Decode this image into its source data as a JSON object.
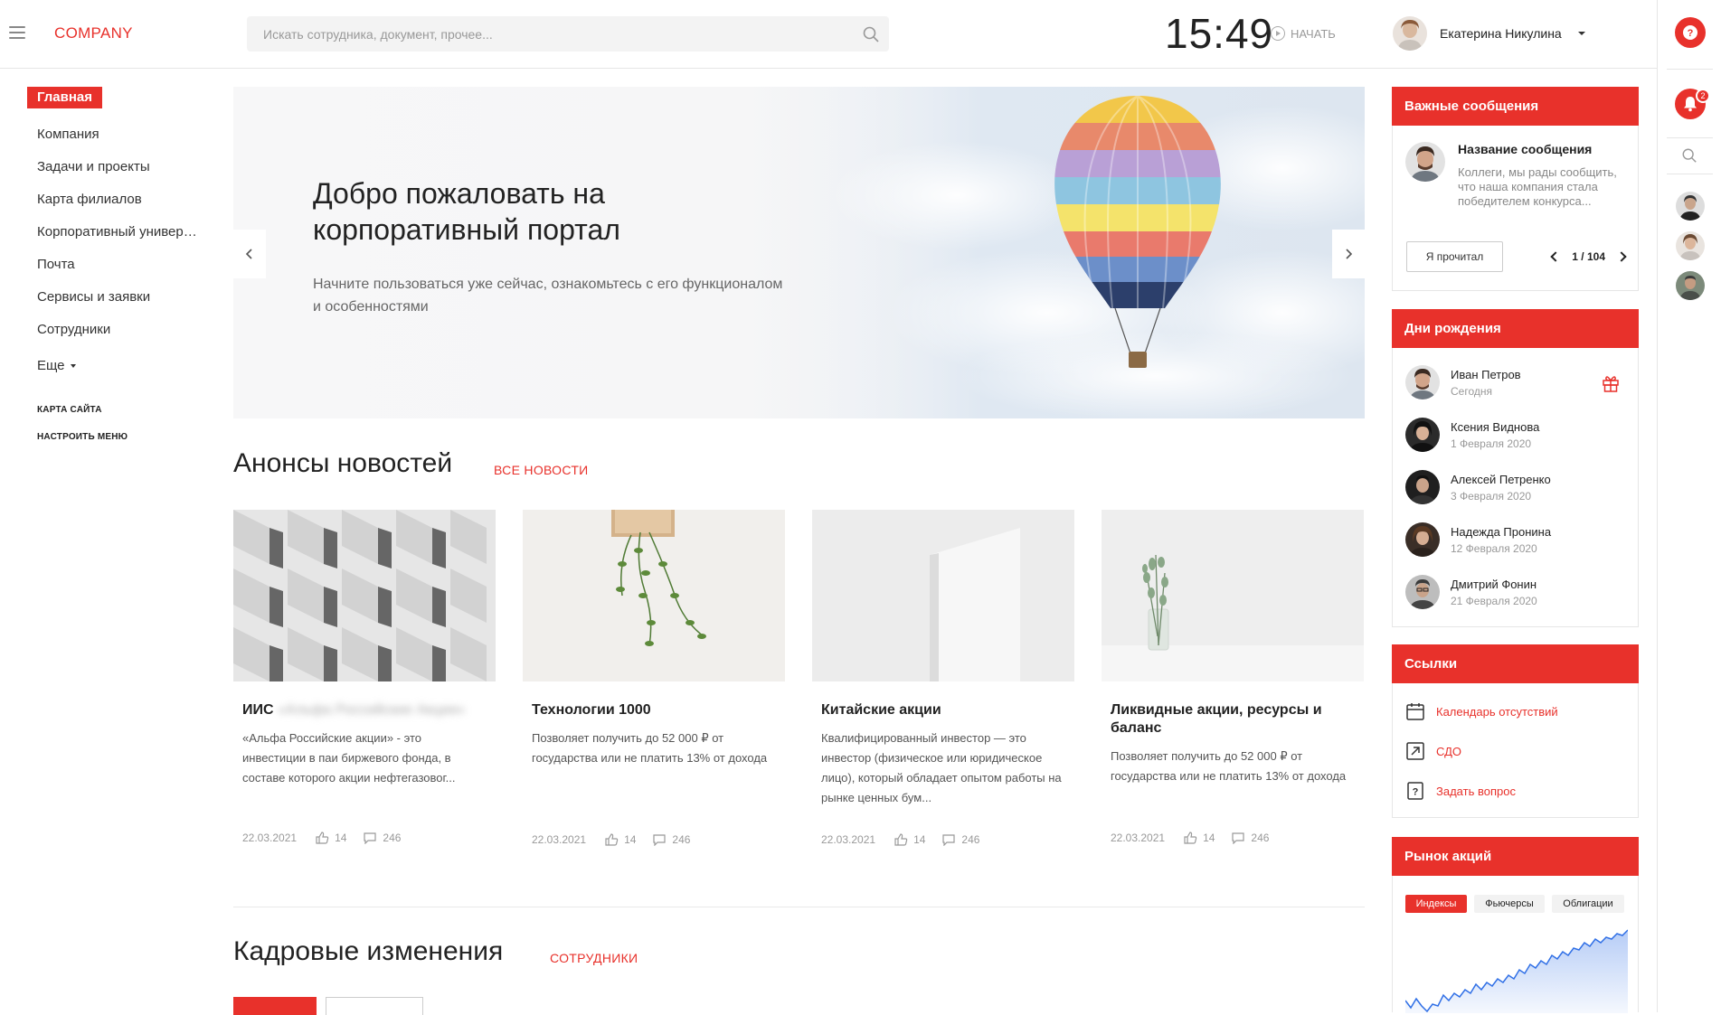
{
  "header": {
    "logo": "COMPANY",
    "search_placeholder": "Искать сотрудника, документ, прочее...",
    "clock": "15:49",
    "start_label": "НАЧАТЬ",
    "user_name": "Екатерина Никулина"
  },
  "rail": {
    "notification_count": "2"
  },
  "sidebar": {
    "items": [
      {
        "label": "Главная",
        "active": true
      },
      {
        "label": "Компания"
      },
      {
        "label": "Задачи и проекты"
      },
      {
        "label": "Карта филиалов"
      },
      {
        "label": "Корпоративный университет"
      },
      {
        "label": "Почта"
      },
      {
        "label": "Сервисы и заявки"
      },
      {
        "label": "Сотрудники"
      },
      {
        "label": "Еще"
      }
    ],
    "sitemap": "КАРТА САЙТА",
    "configure": "НАСТРОИТЬ МЕНЮ"
  },
  "banner": {
    "title": "Добро пожаловать на корпоративный портал",
    "text": "Начните пользоваться уже сейчас, ознакомьтесь с его функционалом и особенностями"
  },
  "news": {
    "title": "Анонсы новостей",
    "link": "ВСЕ НОВОСТИ",
    "cards": [
      {
        "title": "ИИС",
        "title_blur": "«Альфа Российские Акции»",
        "text": "«Альфа Российские акции» - это инвестиции в паи биржевого фонда, в составе которого акции нефтегазовог...",
        "date": "22.03.2021",
        "likes": "14",
        "comments": "246"
      },
      {
        "title": "Технологии 1000",
        "text": "Позволяет получить до 52 000 ₽ от государства или не платить 13% от дохода",
        "date": "22.03.2021",
        "likes": "14",
        "comments": "246"
      },
      {
        "title": "Китайские акции",
        "text": "Квалифицированный инвестор — это инвестор (физическое или юридическое лицо), который обладает опытом работы на рынке ценных бум...",
        "date": "22.03.2021",
        "likes": "14",
        "comments": "246"
      },
      {
        "title": "Ликвидные акции, ресурсы и баланс",
        "text": "Позволяет получить до 52 000 ₽ от государства или не платить 13% от дохода",
        "date": "22.03.2021",
        "likes": "14",
        "comments": "246"
      }
    ]
  },
  "hr": {
    "title": "Кадровые изменения",
    "link": "СОТРУДНИКИ"
  },
  "important": {
    "title": "Важные сообщения",
    "msg_title": "Название сообщения",
    "msg_text": "Коллеги, мы рады сообщить, что наша компания стала победителем конкурса...",
    "button": "Я прочитал",
    "pager": "1 / 104"
  },
  "birthdays": {
    "title": "Дни рождения",
    "people": [
      {
        "name": "Иван Петров",
        "date": "Сегодня"
      },
      {
        "name": "Ксения Виднова",
        "date": "1 Февраля 2020"
      },
      {
        "name": "Алексей Петренко",
        "date": "3 Февраля 2020"
      },
      {
        "name": "Надежда Пронина",
        "date": "12 Февраля 2020"
      },
      {
        "name": "Дмитрий Фонин",
        "date": "21 Февраля 2020"
      }
    ]
  },
  "links": {
    "title": "Ссылки",
    "items": [
      {
        "label": "Календарь отсутствий",
        "icon": "calendar-icon"
      },
      {
        "label": "СДО",
        "icon": "external-link-icon"
      },
      {
        "label": "Задать вопрос",
        "icon": "question-icon"
      }
    ]
  },
  "market": {
    "title": "Рынок акций",
    "tabs": [
      "Индексы",
      "Фьючерсы",
      "Облигации"
    ],
    "active_tab": "Индексы"
  },
  "colors": {
    "accent": "#e8312b"
  }
}
